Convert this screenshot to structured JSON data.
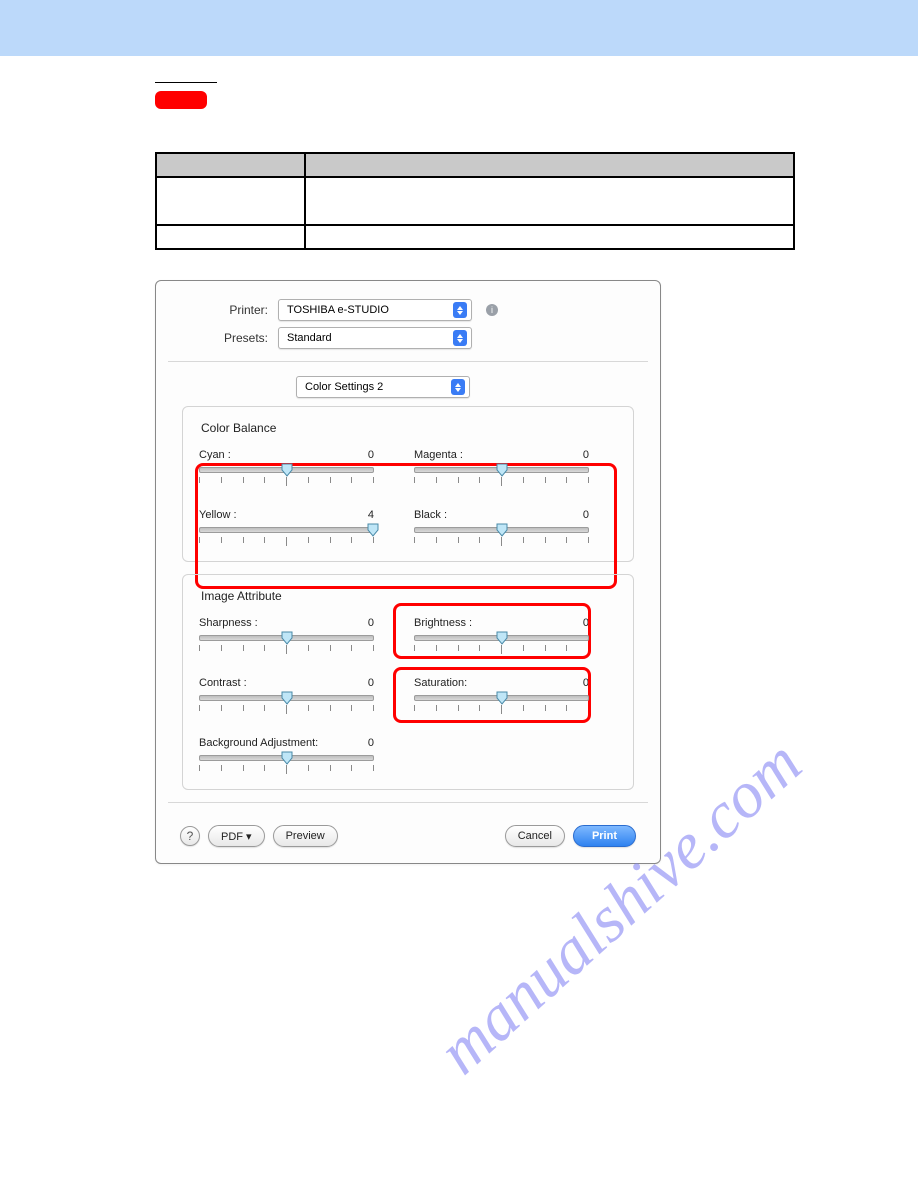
{
  "watermark_text": "manualshive.com",
  "dialog": {
    "printer_label": "Printer:",
    "printer_value": "TOSHIBA e-STUDIO",
    "presets_label": "Presets:",
    "presets_value": "Standard",
    "pane_value": "Color Settings 2",
    "group_balance_title": "Color Balance",
    "group_attr_title": "Image Attribute",
    "sliders": {
      "cyan": {
        "label": "Cyan :",
        "value": "0",
        "pos": 50
      },
      "magenta": {
        "label": "Magenta :",
        "value": "0",
        "pos": 50
      },
      "yellow": {
        "label": "Yellow :",
        "value": "4",
        "pos": 100
      },
      "black": {
        "label": "Black :",
        "value": "0",
        "pos": 50
      },
      "sharpness": {
        "label": "Sharpness :",
        "value": "0",
        "pos": 50
      },
      "brightness": {
        "label": "Brightness :",
        "value": "0",
        "pos": 50
      },
      "contrast": {
        "label": "Contrast :",
        "value": "0",
        "pos": 50
      },
      "saturation": {
        "label": "Saturation:",
        "value": "0",
        "pos": 50
      },
      "background": {
        "label": "Background Adjustment:",
        "value": "0",
        "pos": 50
      }
    },
    "footer": {
      "pdf": "PDF ▾",
      "preview": "Preview",
      "cancel": "Cancel",
      "print": "Print"
    },
    "info_glyph": "i"
  }
}
